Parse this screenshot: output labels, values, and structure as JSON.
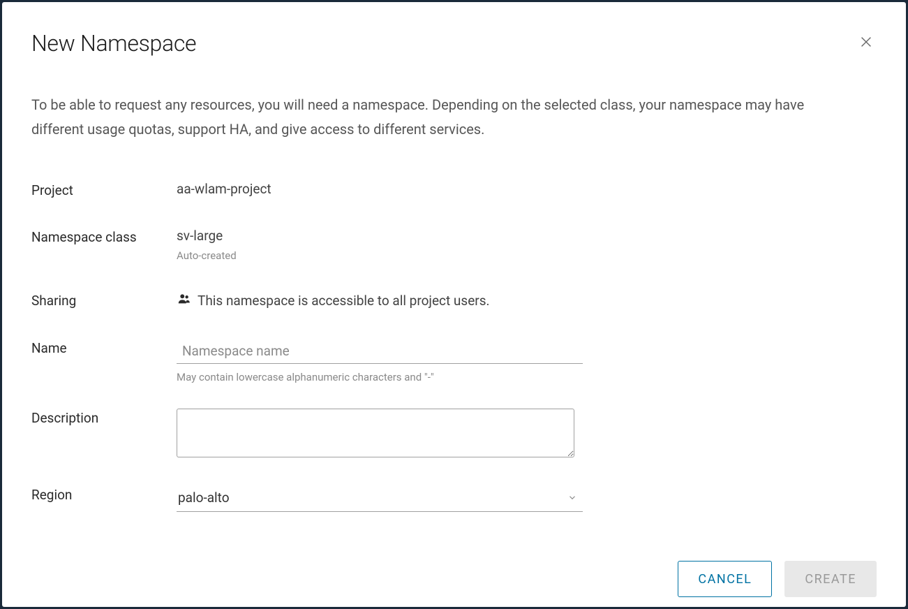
{
  "modal": {
    "title": "New Namespace",
    "intro": "To be able to request any resources, you will need a namespace. Depending on the selected class, your namespace may have different usage quotas, support HA, and give access to different services."
  },
  "labels": {
    "project": "Project",
    "namespace_class": "Namespace class",
    "sharing": "Sharing",
    "name": "Name",
    "description": "Description",
    "region": "Region"
  },
  "values": {
    "project": "aa-wlam-project",
    "namespace_class": "sv-large",
    "namespace_class_sub": "Auto-created",
    "sharing": "This namespace is accessible to all project users.",
    "name": "",
    "name_placeholder": "Namespace name",
    "name_hint": "May contain lowercase alphanumeric characters and \"-\"",
    "description": "",
    "region": "palo-alto"
  },
  "buttons": {
    "cancel": "CANCEL",
    "create": "CREATE"
  }
}
